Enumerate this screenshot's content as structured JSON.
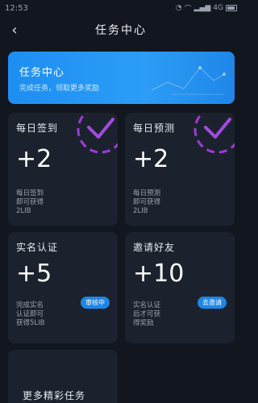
{
  "status_bar": {
    "time": "12:53",
    "network": "4G",
    "battery": ""
  },
  "nav": {
    "title": "任务中心"
  },
  "banner": {
    "title": "任务中心",
    "subtitle": "完成任务，领取更多奖励"
  },
  "cards": [
    {
      "title": "每日签到",
      "value": "+2",
      "desc": [
        "每日签到",
        "即可获得",
        "2LIB"
      ],
      "completed": true
    },
    {
      "title": "每日预测",
      "value": "+2",
      "desc": [
        "每日预测",
        "即可获得",
        "2LIB"
      ],
      "completed": true
    },
    {
      "title": "实名认证",
      "value": "+5",
      "desc": [
        "完成实名",
        "认证即可",
        "获得5LIB"
      ],
      "button": "审核中"
    },
    {
      "title": "邀请好友",
      "value": "+10",
      "desc": [
        "实名认证",
        "后才可获",
        "得奖励"
      ],
      "button": "去邀请"
    }
  ],
  "more": {
    "label": "更多精彩任务"
  },
  "colors": {
    "background": "#12161e",
    "card": "#1c222d",
    "accent_blue": "#1e86e6",
    "check_purple": "#9b3bd6"
  }
}
